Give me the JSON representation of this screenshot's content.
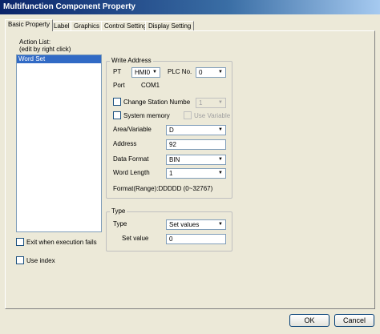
{
  "window": {
    "title": "Multifunction Component Property"
  },
  "tabs": [
    {
      "label": "Basic Property"
    },
    {
      "label": "Label"
    },
    {
      "label": "Graphics"
    },
    {
      "label": "Control Setting"
    },
    {
      "label": "Display Setting"
    }
  ],
  "action_list": {
    "label_line1": "Action List:",
    "label_line2": "(edit by right click)",
    "items": [
      "Word Set"
    ]
  },
  "options": {
    "exit_when_fails": "Exit when execution fails",
    "use_index": "Use index"
  },
  "write_address": {
    "group_title": "Write Address",
    "pt_label": "PT",
    "pt_value": "HMI0",
    "plc_label": "PLC No.",
    "plc_value": "0",
    "port_label": "Port",
    "port_value": "COM1",
    "change_station_label": "Change Station Numbe",
    "station_value": "1",
    "system_memory_label": "System memory",
    "use_variable_label": "Use Variable",
    "area_label": "Area/Variable",
    "area_value": "D",
    "address_label": "Address",
    "address_value": "92",
    "data_format_label": "Data Format",
    "data_format_value": "BIN",
    "word_length_label": "Word Length",
    "word_length_value": "1",
    "format_range": "Format(Range):DDDDD (0~32767)"
  },
  "type_group": {
    "group_title": "Type",
    "type_label": "Type",
    "type_value": "Set values",
    "set_value_label": "Set value",
    "set_value": "0"
  },
  "buttons": {
    "ok": "OK",
    "cancel": "Cancel"
  },
  "icons": {
    "dropdown": "▼"
  }
}
